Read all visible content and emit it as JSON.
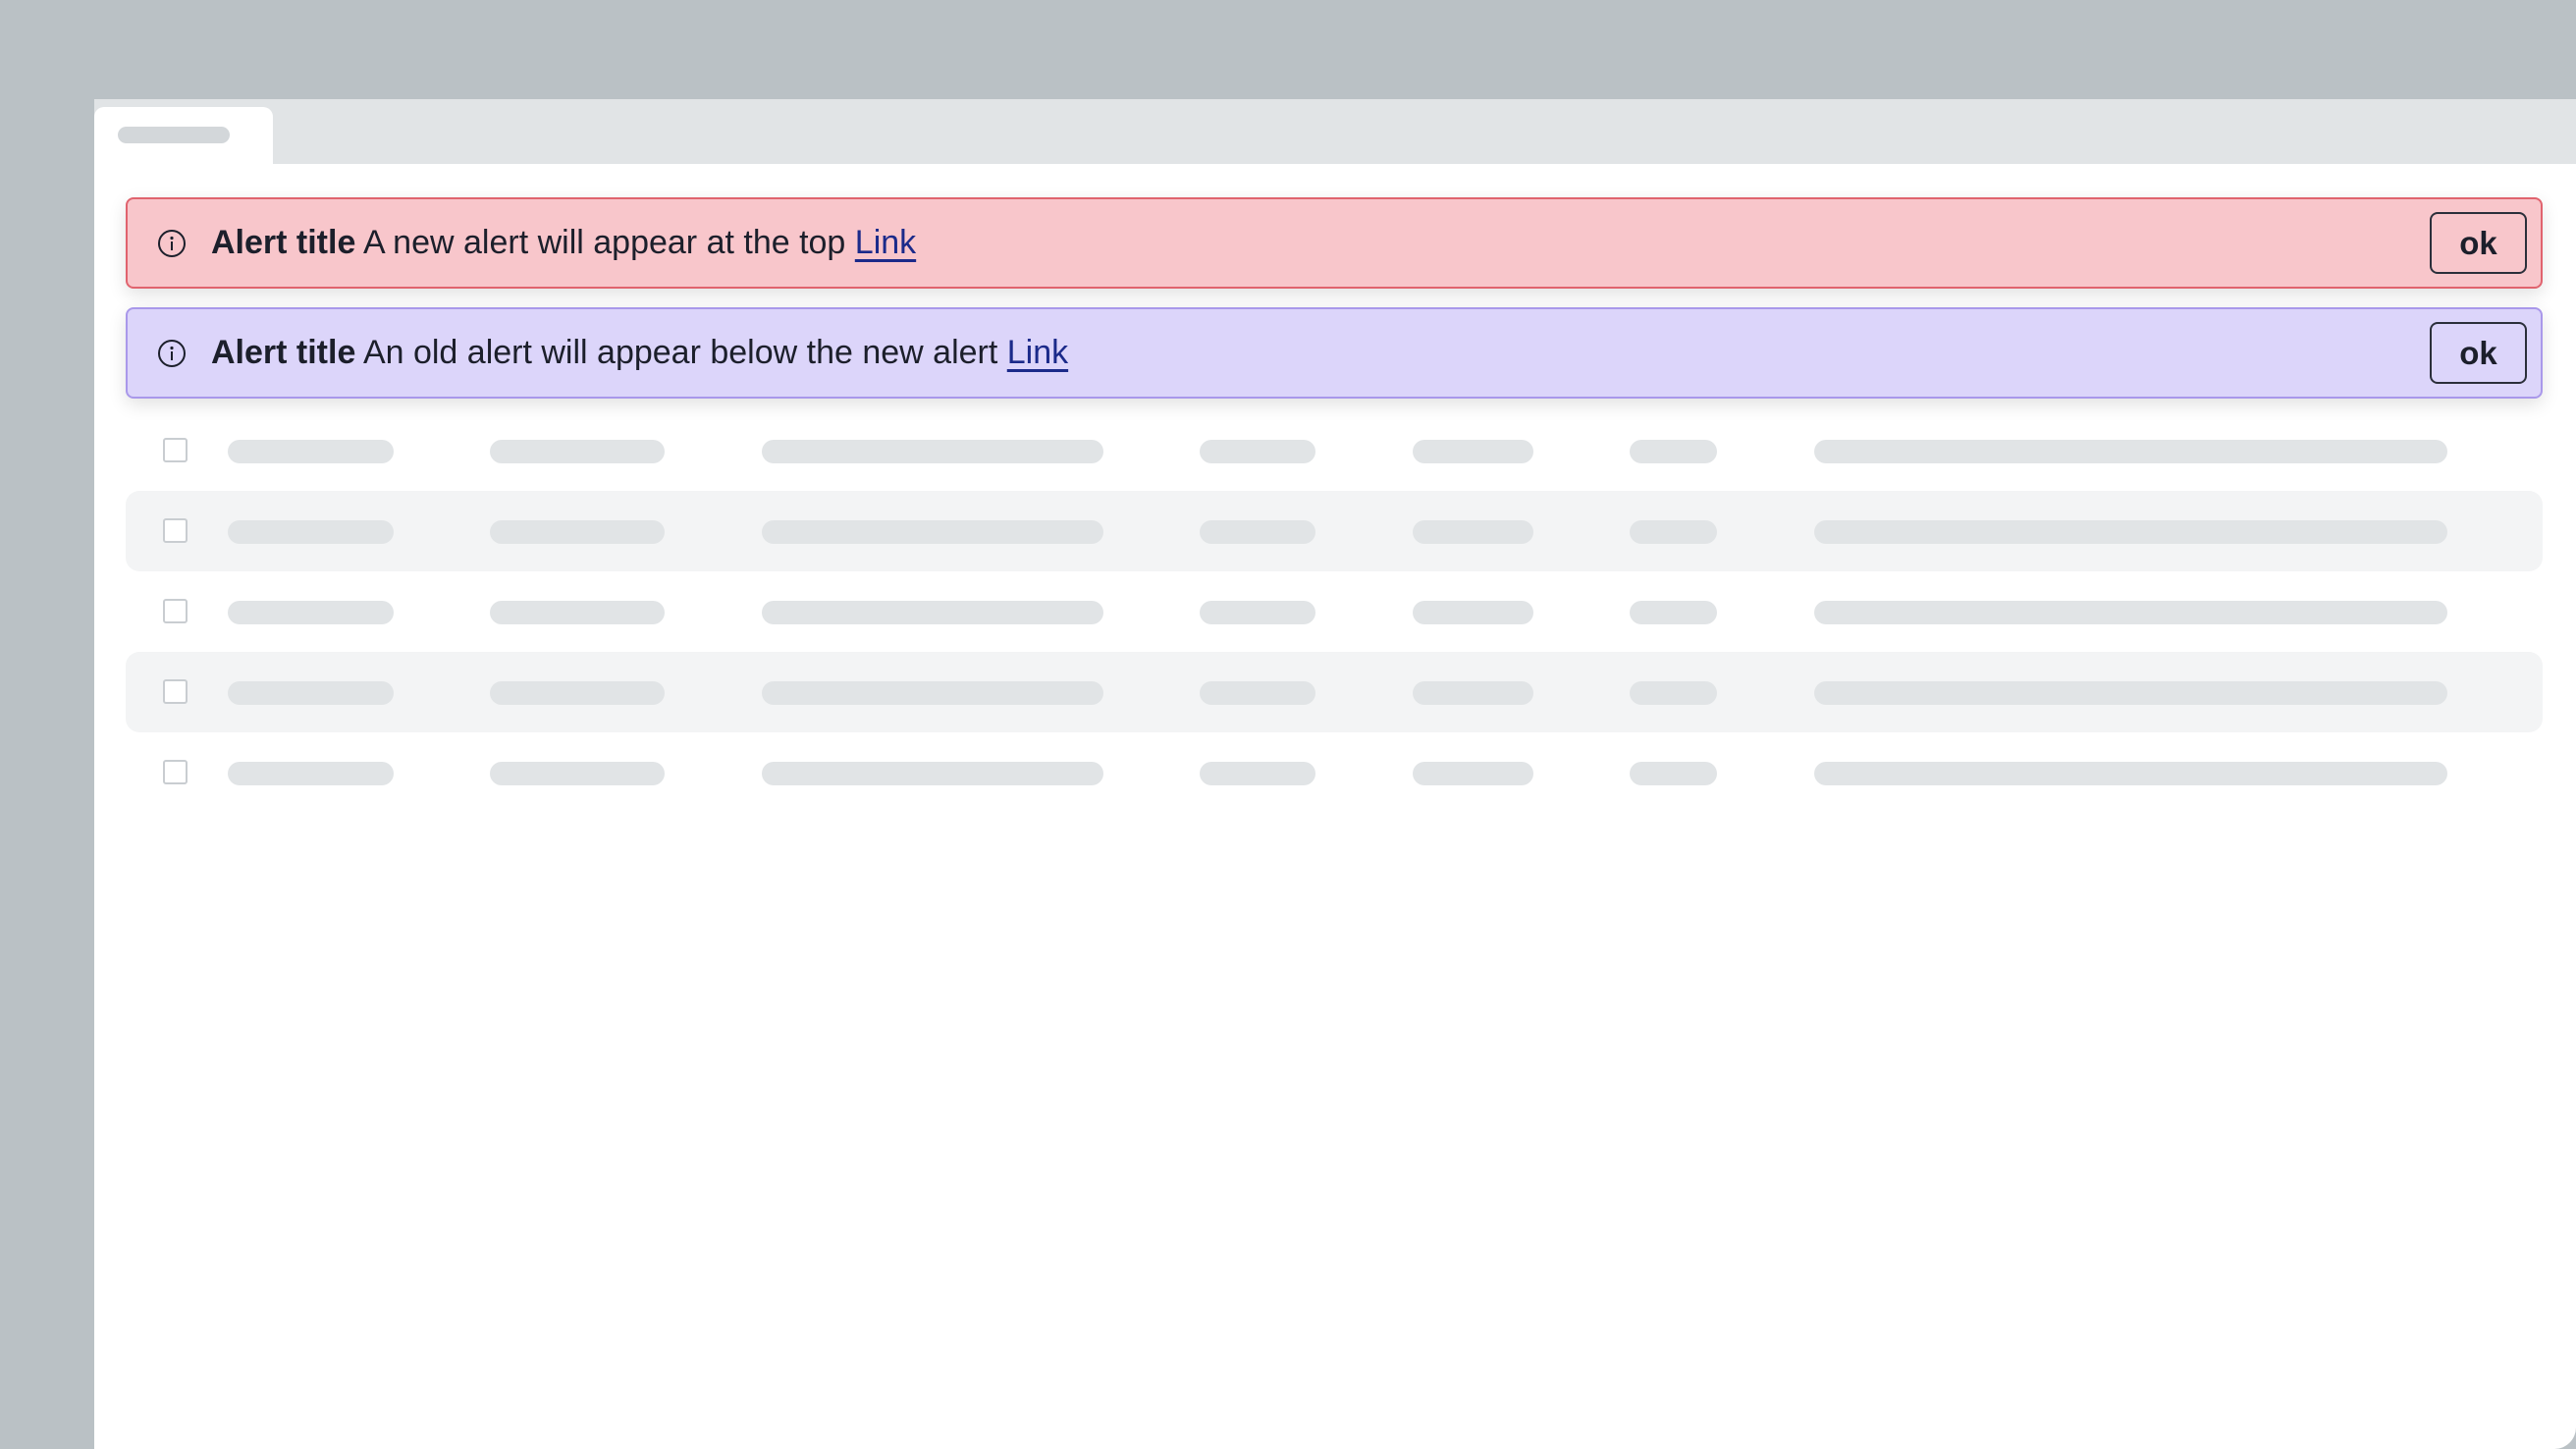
{
  "alerts": [
    {
      "title": "Alert title",
      "message": "A new alert will appear at the top",
      "link": "Link",
      "button": "ok",
      "icon": "info-icon",
      "background": "#f8c6cb",
      "border": "#e0636e"
    },
    {
      "title": "Alert title",
      "message": "An old alert will appear below the new alert",
      "link": "Link",
      "button": "ok",
      "icon": "info-icon",
      "background": "#dcd5fa",
      "border": "#a998ea"
    }
  ],
  "colors": {
    "backdrop": "#bac1c5",
    "tabbar": "#e1e4e6",
    "skeleton": "#e1e4e6",
    "row_alt": "#f3f4f5",
    "link": "#1b2a8a"
  }
}
